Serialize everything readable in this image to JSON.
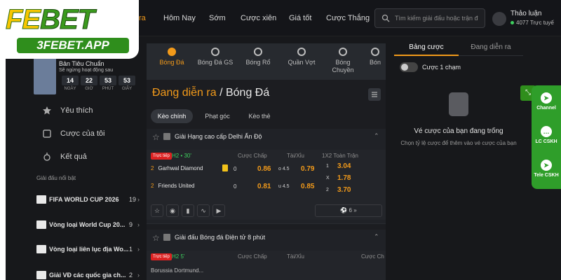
{
  "logo": {
    "brand_a": "FE",
    "brand_b": "BET",
    "domain": "3FEBET.APP"
  },
  "topnav": {
    "items": [
      "ra",
      "Hôm Nay",
      "Sớm",
      "Cược xiên",
      "Giá tốt",
      "Cược Thắng"
    ],
    "search_placeholder": "Tìm kiếm giải đấu hoặc trận đ",
    "chat_title": "Thảo luận",
    "chat_status": "4077 Trực tuyế"
  },
  "profile": {
    "name": "Bản Tiêu Chuẩn",
    "status": "Sẽ ngừng hoạt động sau",
    "countdown": [
      {
        "value": "14",
        "label": "NGÀY"
      },
      {
        "value": "22",
        "label": "GIỜ"
      },
      {
        "value": "53",
        "label": "PHÚT"
      },
      {
        "value": "53",
        "label": "GIÂY"
      }
    ]
  },
  "sidebar": {
    "items": [
      {
        "label": "Yêu thích",
        "icon": "star-icon"
      },
      {
        "label": "Cược của tôi",
        "icon": "ticket-icon"
      },
      {
        "label": "Kết quả",
        "icon": "medal-icon"
      }
    ],
    "featured_title": "Giải đấu nổi bật",
    "leagues": [
      {
        "name": "FIFA WORLD CUP 2026",
        "count": "19"
      },
      {
        "name": "Vòng loại World Cup 20...",
        "count": "9"
      },
      {
        "name": "Vòng loại liên lục địa Wo...",
        "count": "1"
      },
      {
        "name": "Giải VĐ các quốc gia ch...",
        "count": "2"
      }
    ]
  },
  "sports": [
    {
      "label": "Bóng Đá",
      "active": true
    },
    {
      "label": "Bóng Đá GS",
      "active": false
    },
    {
      "label": "Bóng Rổ",
      "active": false
    },
    {
      "label": "Quần Vợt",
      "active": false
    },
    {
      "label": "Bóng",
      "label2": "Chuyền",
      "active": false
    },
    {
      "label": "Bón",
      "active": false
    }
  ],
  "breadcrumb": {
    "parent": "Đang diễn ra",
    "sep": " / ",
    "current": "Bóng Đá"
  },
  "filter_tabs": [
    "Kèo chính",
    "Phạt góc",
    "Kèo thẻ"
  ],
  "table_headers": {
    "handicap": "Cược Chấp",
    "overunder": "Tài/Xỉu",
    "onextwo": "1X2 Toàn Trận"
  },
  "match1": {
    "league": "Giải Hạng cao cấp Delhi Ấn Độ",
    "live_label": "Trực tiếp",
    "time": "H2 • 30'",
    "home": {
      "score": "2",
      "name": "Garhwal Diamond",
      "red": "1",
      "hc": "0",
      "hc_odd": "0.86",
      "ou_lbl": "o 4.5",
      "ou_odd": "0.79",
      "x_lbl": "1",
      "x_odd": "3.04"
    },
    "away": {
      "score": "2",
      "name": "Friends United",
      "hc": "0",
      "hc_odd": "0.81",
      "ou_lbl": "u 4.5",
      "ou_odd": "0.85",
      "x_lbl": "2",
      "x_odd": "3.70"
    },
    "draw": {
      "lbl": "X",
      "odd": "1.78"
    },
    "more": "6"
  },
  "match2": {
    "league": "Giải đấu Bóng đá Điện tử 8 phút",
    "live_label": "Trực tiếp",
    "time": "H2 5'",
    "home_name": "Borussia Dortmund...",
    "header_cut": "Cược Ch"
  },
  "betslip": {
    "tab_active": "Bảng cược",
    "tab_other": "Đang diễn ra",
    "toggle_label": "Cược 1 chạm",
    "empty_title": "Vé cược của bạn đang trống",
    "empty_sub": "Chọn tỷ lệ cược để thêm vào vé cược của bạn"
  },
  "float_menu": [
    {
      "label": "Channel",
      "icon": "telegram-icon"
    },
    {
      "label": "LC CSKH",
      "icon": "chat-icon"
    },
    {
      "label": "Tele CSKH",
      "icon": "telegram-icon"
    }
  ],
  "colors": {
    "accent": "#f29a1a",
    "brand_green": "#2f8e1c",
    "brand_yellow": "#f7c600",
    "live_green": "#3ecf5e"
  }
}
